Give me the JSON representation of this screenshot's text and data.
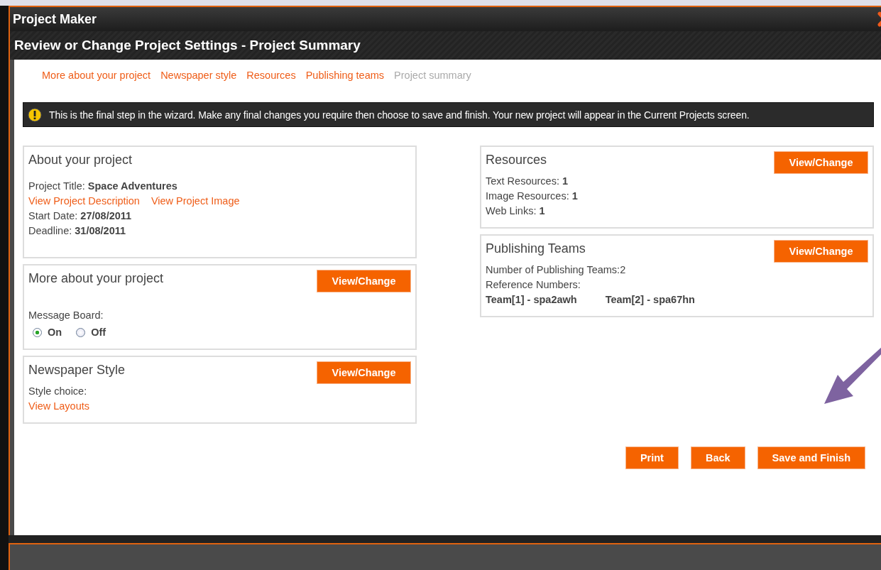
{
  "window": {
    "title": "Project Maker"
  },
  "header": {
    "title": "Review or Change Project Settings - Project Summary"
  },
  "steps": [
    {
      "label": "More about your project",
      "selected": false
    },
    {
      "label": "Newspaper style",
      "selected": false
    },
    {
      "label": "Resources",
      "selected": false
    },
    {
      "label": "Publishing teams",
      "selected": false
    },
    {
      "label": "Project summary",
      "selected": true
    }
  ],
  "notice": {
    "text": "This is the final step in the wizard. Make any final changes you require then choose to save and finish. Your new project will appear in the Current Projects screen."
  },
  "left_panels": [
    {
      "title": "About your project",
      "lines": [
        {
          "kind": "text",
          "text": "Project Title: **Space Adventures**"
        },
        {
          "kind": "links",
          "links": [
            "View Project Description",
            "View Project Image"
          ]
        },
        {
          "kind": "text",
          "text": "Start Date: **27/08/2011**"
        },
        {
          "kind": "text",
          "text": "Deadline: **31/08/2011**"
        }
      ]
    },
    {
      "title": "More about your project",
      "button": "View/Change",
      "lines": [
        {
          "kind": "text",
          "text": "Message Board:"
        },
        {
          "kind": "radio",
          "options": [
            {
              "label": "On",
              "selected": true
            },
            {
              "label": "Off",
              "selected": false
            }
          ]
        }
      ]
    },
    {
      "title": "Newspaper Style",
      "button": "View/Change",
      "lines": [
        {
          "kind": "text",
          "text": "Style choice:"
        },
        {
          "kind": "links",
          "links": [
            "View Layouts"
          ]
        }
      ]
    }
  ],
  "right_panels": [
    {
      "title": "Resources",
      "button": "View/Change",
      "lines": [
        {
          "kind": "text",
          "text": "Text Resources: **1**"
        },
        {
          "kind": "text",
          "text": "Image Resources: **1**"
        },
        {
          "kind": "text",
          "text": "Web Links: **1**"
        }
      ]
    },
    {
      "title": "Publishing Teams",
      "button": "View/Change",
      "lines": [
        {
          "kind": "text",
          "text": "Number of Publishing Teams:2"
        },
        {
          "kind": "text",
          "text": "Reference Numbers:"
        },
        {
          "kind": "refs",
          "items": [
            "Team[1] - spa2awh",
            "Team[2] - spa67hn"
          ]
        }
      ]
    }
  ],
  "actions": [
    "Print",
    "Back",
    "Save and Finish"
  ]
}
